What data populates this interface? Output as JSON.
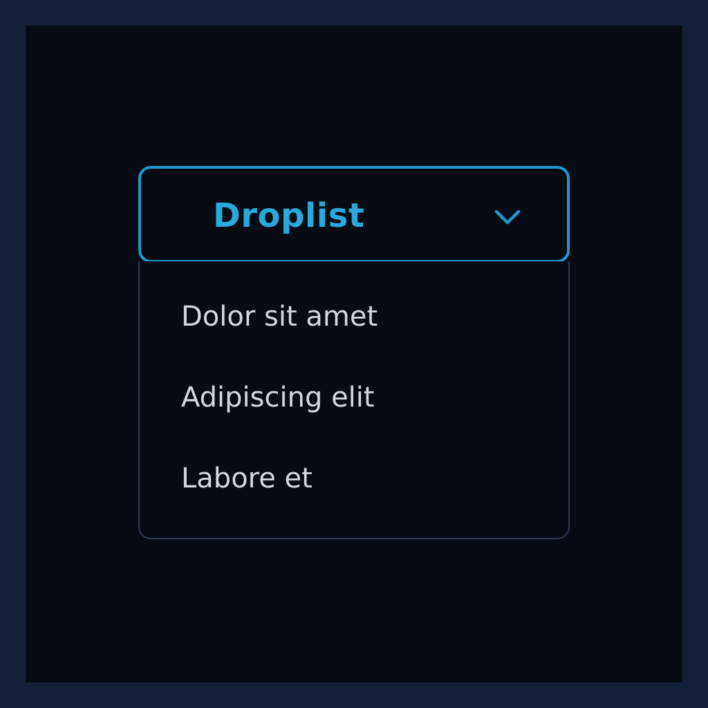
{
  "dropdown": {
    "label": "Droplist",
    "icon": "chevron-down-icon",
    "accent_color": "#1e99c9",
    "items": [
      {
        "label": "Dolor sit amet"
      },
      {
        "label": "Adipiscing elit"
      },
      {
        "label": "Labore et"
      }
    ]
  },
  "colors": {
    "page_background": "#142036",
    "panel_background": "#070b14",
    "menu_border": "#2b3a52",
    "item_text": "#d4d8de"
  }
}
